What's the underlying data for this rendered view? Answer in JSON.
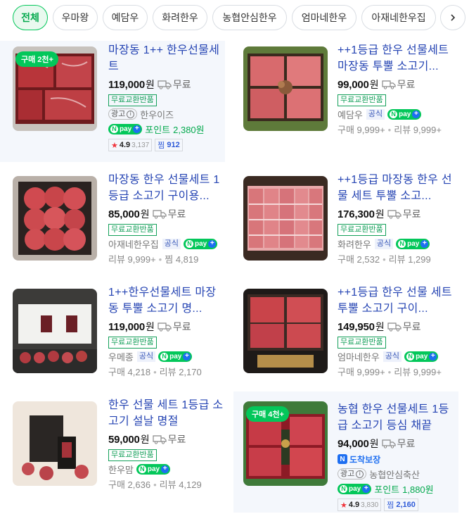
{
  "filters": {
    "chips": [
      "전체",
      "우마왕",
      "예담우",
      "화려한우",
      "농협안심한우",
      "엄마네한우",
      "아재네한우집"
    ],
    "next_icon": "chevron-right-icon"
  },
  "colors": {
    "accent": "#03c75a",
    "link": "#2544b3",
    "npay_plus": "#1e6ff1",
    "star": "#f0343c"
  },
  "products": [
    {
      "badge": "구매 2천+",
      "title": "마장동 1++ 한우선물세트",
      "price": "119,000",
      "price_unit": "원",
      "shipping": "무료",
      "tag": "무료교환반품",
      "ad_label": "광고",
      "seller": "한우이즈",
      "npay_label": "pay",
      "point_label": "포인트",
      "point_value": "2,380원",
      "rating_score": "4.9",
      "rating_count": "3,137",
      "jjim_label": "찜",
      "jjim_count": "912"
    },
    {
      "title": "++1등급 한우 선물세트 마장동 투뿔 소고기...",
      "price": "99,000",
      "price_unit": "원",
      "shipping": "무료",
      "tag": "무료교환반품",
      "seller": "예담우",
      "official": "공식",
      "npay_label": "pay",
      "meta1_label": "구매",
      "meta1_value": "9,999+",
      "meta2_label": "리뷰",
      "meta2_value": "9,999+"
    },
    {
      "title": "마장동 한우 선물세트 1등급 소고기 구이용...",
      "price": "85,000",
      "price_unit": "원",
      "shipping": "무료",
      "tag": "무료교환반품",
      "seller": "아재네한우집",
      "official": "공식",
      "npay_label": "pay",
      "meta1_label": "리뷰",
      "meta1_value": "9,999+",
      "meta2_label": "찜",
      "meta2_value": "4,819"
    },
    {
      "title": "++1등급 마장동 한우 선물 세트 투뿔 소고...",
      "price": "176,300",
      "price_unit": "원",
      "shipping": "무료",
      "tag": "무료교환반품",
      "seller": "화려한우",
      "official": "공식",
      "npay_label": "pay",
      "meta1_label": "구매",
      "meta1_value": "2,532",
      "meta2_label": "리뷰",
      "meta2_value": "1,299"
    },
    {
      "title": "1++한우선물세트 마장동 투뿔 소고기 명...",
      "price": "119,000",
      "price_unit": "원",
      "shipping": "무료",
      "tag": "무료교환반품",
      "seller": "우메종",
      "official": "공식",
      "npay_label": "pay",
      "meta1_label": "구매",
      "meta1_value": "4,218",
      "meta2_label": "리뷰",
      "meta2_value": "2,170"
    },
    {
      "title": "++1등급 한우 선물 세트 투뿔 소고기 구이...",
      "price": "149,950",
      "price_unit": "원",
      "shipping": "무료",
      "tag": "무료교환반품",
      "seller": "엄마네한우",
      "official": "공식",
      "npay_label": "pay",
      "meta1_label": "구매",
      "meta1_value": "9,999+",
      "meta2_label": "리뷰",
      "meta2_value": "9,999+"
    },
    {
      "title": "한우 선물 세트 1등급 소고기 설날 명절",
      "price": "59,000",
      "price_unit": "원",
      "shipping": "무료",
      "tag": "무료교환반품",
      "seller": "한우맘",
      "npay_label": "pay",
      "meta1_label": "구매",
      "meta1_value": "2,636",
      "meta2_label": "리뷰",
      "meta2_value": "4,129"
    },
    {
      "badge": "구매 4천+",
      "title": "농협 한우 선물세트 1등급 소고기 등심 채끝",
      "price": "94,000",
      "price_unit": "원",
      "shipping": "무료",
      "delivery_label": "도착보장",
      "ad_label": "광고",
      "seller": "농협안심축산",
      "npay_label": "pay",
      "point_label": "포인트",
      "point_value": "1,880원",
      "rating_score": "4.9",
      "rating_count": "3,830",
      "jjim_label": "찜",
      "jjim_count": "2,160"
    }
  ]
}
